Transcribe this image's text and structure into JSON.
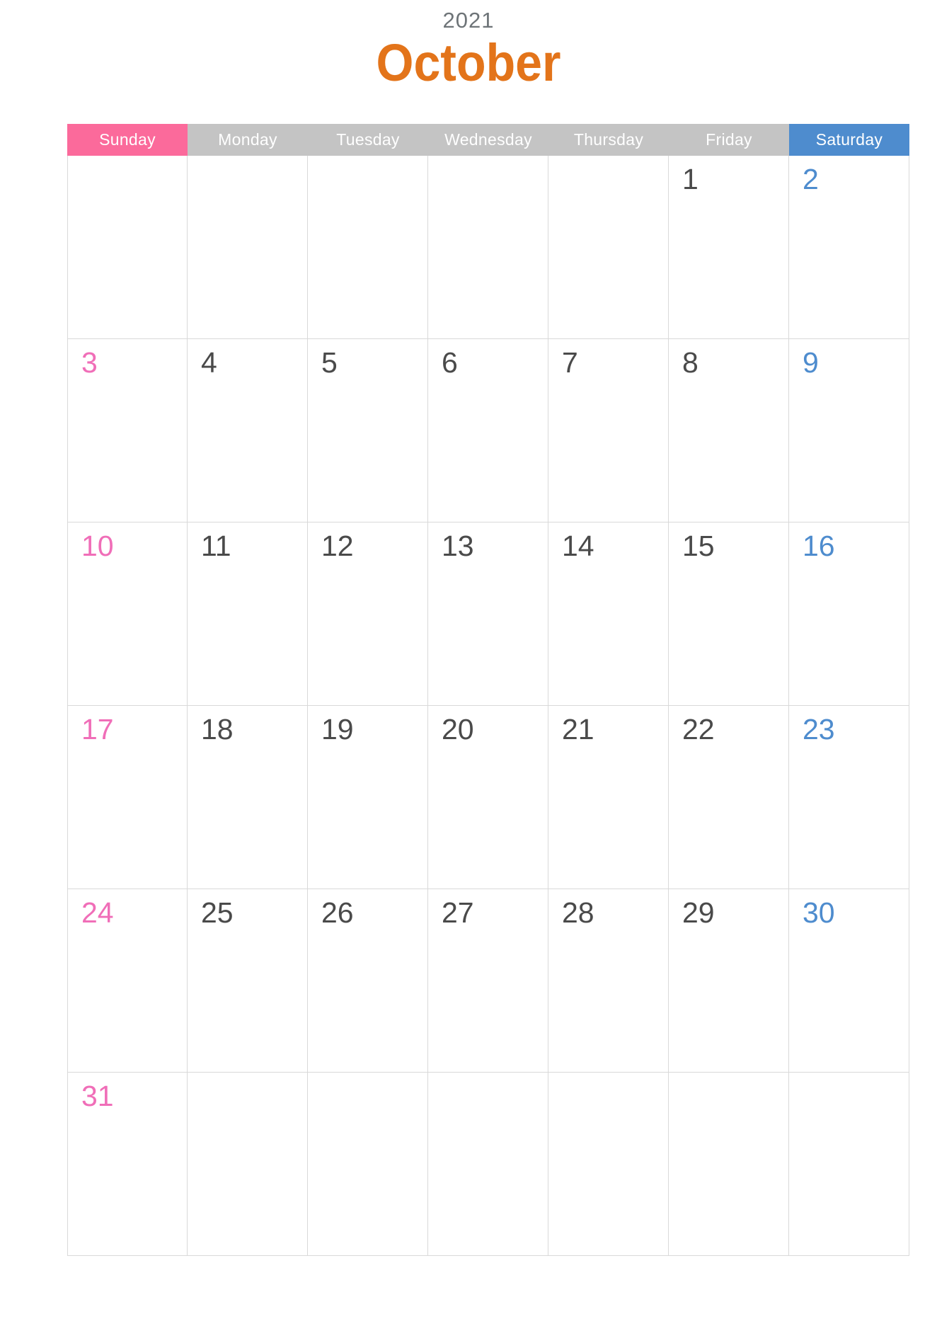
{
  "title": {
    "year": "2021",
    "month": "October"
  },
  "colors": {
    "year_text": "#6e7478",
    "month_text": "#e3741a",
    "sunday_header_bg": "#fb6a9b",
    "weekday_header_bg": "#c4c4c4",
    "saturday_header_bg": "#4e8cce",
    "header_text": "#ffffff",
    "sunday_date": "#f06eb8",
    "saturday_date": "#4e8cce",
    "weekday_date": "#4a4a4a",
    "grid_line": "#d9d9d9",
    "page_bg": "#ffffff"
  },
  "weekdays": [
    {
      "label": "Sunday",
      "kind": "sunday"
    },
    {
      "label": "Monday",
      "kind": "weekday"
    },
    {
      "label": "Tuesday",
      "kind": "weekday"
    },
    {
      "label": "Wednesday",
      "kind": "weekday"
    },
    {
      "label": "Thursday",
      "kind": "weekday"
    },
    {
      "label": "Friday",
      "kind": "weekday"
    },
    {
      "label": "Saturday",
      "kind": "saturday"
    }
  ],
  "weeks": [
    [
      {
        "day": "",
        "kind": "sunday"
      },
      {
        "day": "",
        "kind": "weekday"
      },
      {
        "day": "",
        "kind": "weekday"
      },
      {
        "day": "",
        "kind": "weekday"
      },
      {
        "day": "",
        "kind": "weekday"
      },
      {
        "day": "1",
        "kind": "weekday"
      },
      {
        "day": "2",
        "kind": "saturday"
      }
    ],
    [
      {
        "day": "3",
        "kind": "sunday"
      },
      {
        "day": "4",
        "kind": "weekday"
      },
      {
        "day": "5",
        "kind": "weekday"
      },
      {
        "day": "6",
        "kind": "weekday"
      },
      {
        "day": "7",
        "kind": "weekday"
      },
      {
        "day": "8",
        "kind": "weekday"
      },
      {
        "day": "9",
        "kind": "saturday"
      }
    ],
    [
      {
        "day": "10",
        "kind": "sunday"
      },
      {
        "day": "11",
        "kind": "weekday"
      },
      {
        "day": "12",
        "kind": "weekday"
      },
      {
        "day": "13",
        "kind": "weekday"
      },
      {
        "day": "14",
        "kind": "weekday"
      },
      {
        "day": "15",
        "kind": "weekday"
      },
      {
        "day": "16",
        "kind": "saturday"
      }
    ],
    [
      {
        "day": "17",
        "kind": "sunday"
      },
      {
        "day": "18",
        "kind": "weekday"
      },
      {
        "day": "19",
        "kind": "weekday"
      },
      {
        "day": "20",
        "kind": "weekday"
      },
      {
        "day": "21",
        "kind": "weekday"
      },
      {
        "day": "22",
        "kind": "weekday"
      },
      {
        "day": "23",
        "kind": "saturday"
      }
    ],
    [
      {
        "day": "24",
        "kind": "sunday"
      },
      {
        "day": "25",
        "kind": "weekday"
      },
      {
        "day": "26",
        "kind": "weekday"
      },
      {
        "day": "27",
        "kind": "weekday"
      },
      {
        "day": "28",
        "kind": "weekday"
      },
      {
        "day": "29",
        "kind": "weekday"
      },
      {
        "day": "30",
        "kind": "saturday"
      }
    ],
    [
      {
        "day": "31",
        "kind": "sunday"
      },
      {
        "day": "",
        "kind": "weekday"
      },
      {
        "day": "",
        "kind": "weekday"
      },
      {
        "day": "",
        "kind": "weekday"
      },
      {
        "day": "",
        "kind": "weekday"
      },
      {
        "day": "",
        "kind": "weekday"
      },
      {
        "day": "",
        "kind": "saturday"
      }
    ]
  ]
}
